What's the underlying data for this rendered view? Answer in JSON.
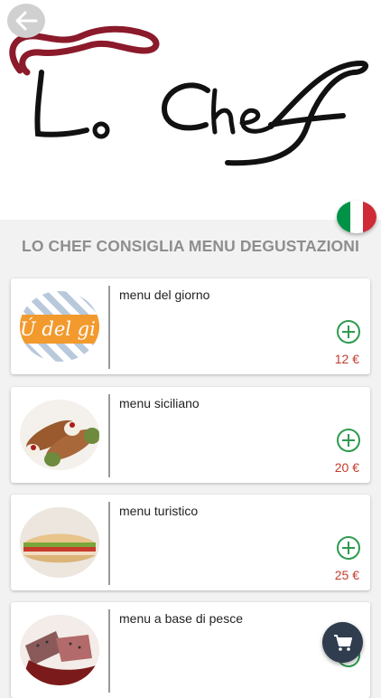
{
  "header": {
    "logo_text": "Lo Chef",
    "back_icon": "arrow-left-icon",
    "language_flag": "italy-flag-icon"
  },
  "section_title": "LO CHEF CONSIGLIA MENU DEGUSTAZIONI",
  "menus": [
    {
      "title": "menu del giorno",
      "price": "12 €",
      "image": "menu-del-giorno-image",
      "image_text": "Ú del gi"
    },
    {
      "title": "menu siciliano",
      "price": "20 €",
      "image": "cannoli-image"
    },
    {
      "title": "menu turistico",
      "price": "25 €",
      "image": "sandwich-image"
    },
    {
      "title": "menu a base di pesce",
      "price": "",
      "image": "tuna-image"
    }
  ],
  "cart": {
    "icon": "shopping-cart-icon"
  },
  "colors": {
    "accent_green": "#2e9a4e",
    "price_red": "#c23c2c",
    "fab": "#2f3d4e",
    "logo_red": "#8b1a2b"
  }
}
